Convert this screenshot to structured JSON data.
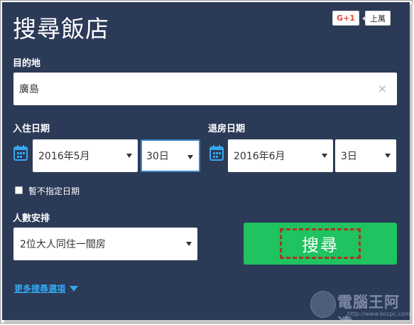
{
  "header": {
    "title": "搜尋飯店"
  },
  "gplus": {
    "button_label": "G+1",
    "count_label": "上萬"
  },
  "destination": {
    "label": "目的地",
    "value": "廣島",
    "clear_glyph": "×"
  },
  "checkin": {
    "label": "入住日期",
    "month_value": "2016年5月",
    "day_value": "30日"
  },
  "checkout": {
    "label": "退房日期",
    "month_value": "2016年6月",
    "day_value": "3日"
  },
  "no_dates": {
    "label": "暫不指定日期",
    "checked": false
  },
  "guests": {
    "label": "人數安排",
    "value": "2位大人同住一間房"
  },
  "search_button": {
    "label": "搜尋"
  },
  "more_options": {
    "label": "更多搜尋選項"
  },
  "watermark": {
    "brand": "電腦王阿達",
    "url": "http://www.kocpc.com.tw"
  },
  "colors": {
    "panel": "#2b3a57",
    "search": "#1fc35f",
    "link": "#34a7ef",
    "focus": "#3d86c6"
  },
  "icons": {
    "calendar": "calendar-icon",
    "dropdown": "chevron-down-icon"
  }
}
